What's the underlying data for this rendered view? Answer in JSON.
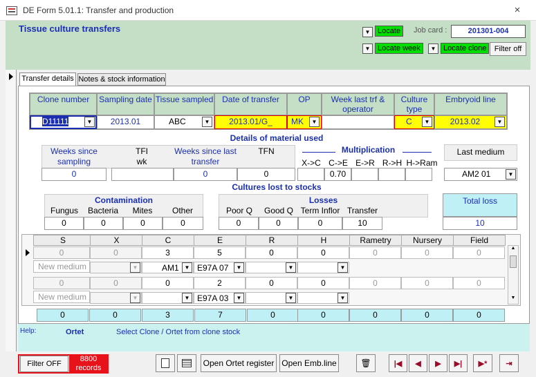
{
  "window": {
    "title": "DE Form 5.01.1: Transfer and production",
    "close": "×"
  },
  "header": {
    "title": "Tissue culture transfers",
    "locate": "Locate",
    "job_card_label": "Job card :",
    "job_card_value": "201301-004",
    "locate_week": "Locate week",
    "locate_clone": "Locate clone",
    "filter_off": "Filter off"
  },
  "tabs": [
    "Transfer details",
    "Notes & stock information"
  ],
  "top_fields": {
    "headers": [
      "Clone number",
      "Sampling date",
      "Tissue sampled",
      "Date of transfer",
      "OP",
      "Week last trf & operator",
      "Culture type",
      "Embryoid line"
    ],
    "values": {
      "clone": "D11111",
      "sampling_date": "2013.01",
      "tissue": "ABC",
      "date_transfer": "2013.01/G_",
      "op": "MK",
      "week_last": "",
      "culture_type": "C",
      "embryoid": "2013.02"
    }
  },
  "material": {
    "title": "Details of material used",
    "weeks_since_sampling": "Weeks since sampling",
    "wss_val": "0",
    "tfi": "TFI",
    "tfi_wk": "wk",
    "tfi_val": "",
    "weeks_since_last": "Weeks since last transfer",
    "wsl_val": "0",
    "tfn": "TFN",
    "tfn_val": "0",
    "multiplication": "Multiplication",
    "mult_cols": [
      "X->C",
      "C->E",
      "E->R",
      "R->H",
      "H->Ram"
    ],
    "mult_vals": [
      "",
      "0.70",
      "",
      "",
      ""
    ],
    "last_medium": "Last medium",
    "last_medium_val": "AM2 01"
  },
  "lost": {
    "title": "Cultures lost to stocks",
    "contamination": "Contamination",
    "cont_cols": [
      "Fungus",
      "Bacteria",
      "Mites",
      "Other"
    ],
    "cont_vals": [
      "0",
      "0",
      "0",
      "0"
    ],
    "losses": "Losses",
    "loss_cols": [
      "Poor Q",
      "Good Q",
      "Term Inflor",
      "Transfer"
    ],
    "loss_vals": [
      "0",
      "0",
      "0",
      "10"
    ],
    "total_loss": "Total loss",
    "total_val": "10"
  },
  "grid": {
    "cols": [
      "S",
      "X",
      "C",
      "E",
      "R",
      "H",
      "Rametry",
      "Nursery",
      "Field"
    ],
    "rows": [
      {
        "vals": [
          "0",
          "0",
          "3",
          "5",
          "0",
          "0",
          "0",
          "0",
          "0"
        ],
        "medium_label": "New medium",
        "c_med": "AM1",
        "e_med": "E97A 07"
      },
      {
        "vals": [
          "0",
          "0",
          "0",
          "2",
          "0",
          "0",
          "0",
          "0",
          "0"
        ],
        "medium_label": "New medium",
        "c_med": "",
        "e_med": "E97A 03"
      }
    ],
    "totals": [
      "0",
      "0",
      "3",
      "7",
      "0",
      "0",
      "0",
      "0",
      "0"
    ]
  },
  "help": {
    "label": "Help:",
    "field": "Ortet",
    "text": "Select Clone / Ortet from clone stock"
  },
  "bottom": {
    "filter_off": "Filter OFF",
    "records": "8800 records",
    "open_ortet": "Open Ortet register",
    "open_emb": "Open Emb.line"
  },
  "colors": {
    "header_bg": "#c5dfc7",
    "title_blue": "#1a2fb0",
    "locate_green": "#00e000",
    "yellow": "#ffff00",
    "records_red": "#e8121b",
    "total_cyan": "#bff0f5"
  }
}
